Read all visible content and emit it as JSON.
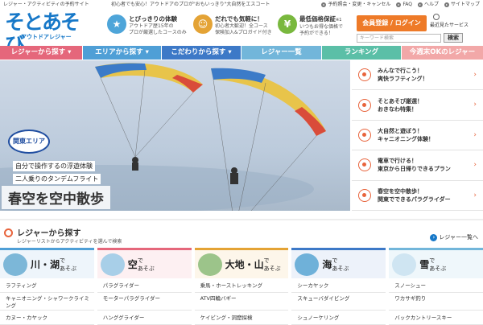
{
  "topbar": {
    "tagline1": "レジャー・アクティビティの予約サイト",
    "tagline2": "初心者でも安心！アウトドアのプロが\"おもいっきり\"大自然をエスコート",
    "links": [
      {
        "label": "予約照会・変更・キャンセル",
        "icon": "reservation-icon"
      },
      {
        "label": "FAQ",
        "icon": "faq-icon"
      },
      {
        "label": "ヘルプ",
        "icon": "help-icon"
      },
      {
        "label": "サイトマップ",
        "icon": "sitemap-icon"
      }
    ]
  },
  "logo": {
    "main": "そとあそび",
    "sub": "アウトドアレジャー"
  },
  "features": [
    {
      "title": "とびっきりの体験",
      "desc1": "アウトドア歴15年の",
      "desc2": "プロが厳選したコースのみ",
      "color": "#4ea5d9",
      "icon": "★"
    },
    {
      "title": "だれでも気軽に！",
      "desc1": "初心者大歓迎！全コース",
      "desc2": "保険加入&プロガイド付き",
      "color": "#e4a335",
      "icon": "☺"
    },
    {
      "title": "最低価格保証",
      "note": "※1",
      "desc1": "いつもお得な価格で",
      "desc2": "予約ができる！",
      "color": "#79b83e",
      "icon": "¥"
    }
  ],
  "header": {
    "register_label": "会員登録 / ログイン",
    "recent_label": "最近見たサービス",
    "search_placeholder": "キーワード検索",
    "search_button": "検索"
  },
  "nav": [
    {
      "label": "レジャーから探す ▾",
      "color": "#e5677b"
    },
    {
      "label": "エリアから探す ▾",
      "color": "#4f9fd6"
    },
    {
      "label": "こだわりから探す ▾",
      "color": "#3d79c7"
    },
    {
      "label": "レジャー一覧",
      "color": "#72b6da"
    },
    {
      "label": "ランキング",
      "color": "#5bbfa7"
    },
    {
      "label": "今週末OKのレジャー",
      "color": "#f2a8a8"
    }
  ],
  "hero": {
    "badge": "関東エリア",
    "line1": "自分で操作するの浮遊体験",
    "line2": "二人乗りのタンデムフライト",
    "headline": "春空を空中散歩"
  },
  "side_items": [
    {
      "line1": "みんなで行こう！",
      "line2": "爽快ラフティング！"
    },
    {
      "line1": "そとあそび厳選！",
      "line2": "おきなわ特集！"
    },
    {
      "line1": "大自然と遊ぼう！",
      "line2": "キャニオニング体験！"
    },
    {
      "line1": "電車で行ける！",
      "line2": "東京から日帰りできるプラン"
    },
    {
      "line1": "春空を空中散歩！",
      "line2": "関東でできるパラグライダー"
    }
  ],
  "leisure_search": {
    "title": "レジャーから探す",
    "subtitle": "レジャーリストからアクティビティを選んで検索",
    "all_link": "レジャー一覧へ"
  },
  "categories": [
    {
      "name": "川・湖",
      "suffix": "で",
      "suffix2": "あそぶ",
      "color": "#4f9fd6",
      "pic": "#7cb7d8",
      "items": [
        "ラフティング",
        "キャニオニング・シャワークライミング",
        "カヌー・カヤック"
      ]
    },
    {
      "name": "空",
      "suffix": "で",
      "suffix2": "あそぶ",
      "color": "#e5677b",
      "pic": "#a8cfe8",
      "items": [
        "パラグライダー",
        "モーターパラグライダー",
        "ハンググライダー"
      ]
    },
    {
      "name": "大地・山",
      "suffix": "で",
      "suffix2": "あそぶ",
      "color": "#e4a335",
      "pic": "#9cc48a",
      "items": [
        "乗馬・ホーストレッキング",
        "ATV四輪バギー",
        "ケイビング・洞窟探検"
      ]
    },
    {
      "name": "海",
      "suffix": "で",
      "suffix2": "あそぶ",
      "color": "#3d79c7",
      "pic": "#6fb1d9",
      "items": [
        "シーカヤック",
        "スキューバダイビング",
        "シュノーケリング"
      ]
    },
    {
      "name": "雪",
      "suffix": "で",
      "suffix2": "あそぶ",
      "color": "#72b6da",
      "pic": "#cfe5f2",
      "items": [
        "スノーシュー",
        "ワカサギ釣り",
        "バックカントリースキー"
      ]
    }
  ]
}
